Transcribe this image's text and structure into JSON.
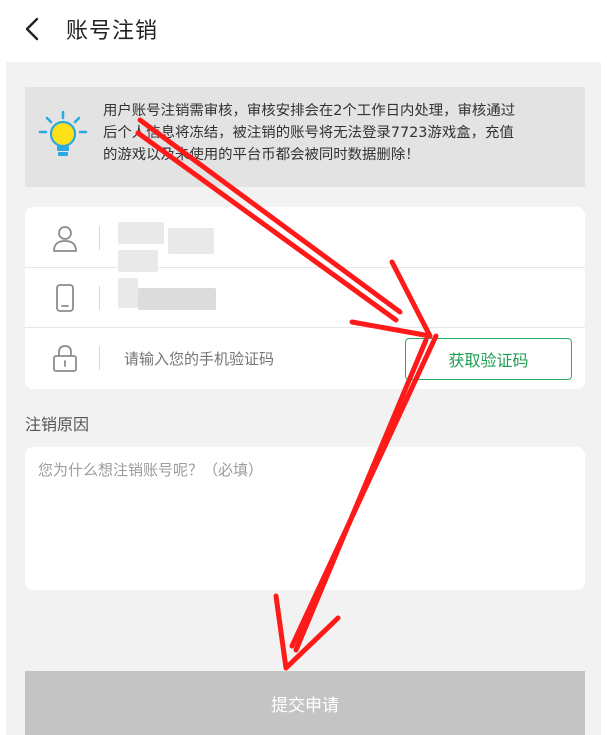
{
  "header": {
    "title": "账号注销",
    "back_icon": "chevron-left-icon"
  },
  "notice": {
    "icon": "lightbulb-icon",
    "line1": "用户账号注销需审核，审核安排会在2个工作日内处理，审核通过",
    "line2": "后个人信息将冻结，被注销的账号将无法登录7723游戏盒，充值",
    "line3": "的游戏以及未使用的平台币都会被同时数据删除！"
  },
  "form": {
    "user_icon": "user-icon",
    "phone_icon": "phone-icon",
    "lock_icon": "lock-icon",
    "code_placeholder": "请输入您的手机验证码",
    "get_code_label": "获取验证码"
  },
  "reason": {
    "label": "注销原因",
    "placeholder": "您为什么想注销账号呢？（必填）"
  },
  "submit_label": "提交申请",
  "colors": {
    "accent": "#27b063",
    "annotation": "#ff1a1a",
    "submit_disabled": "#c4c4c4"
  }
}
